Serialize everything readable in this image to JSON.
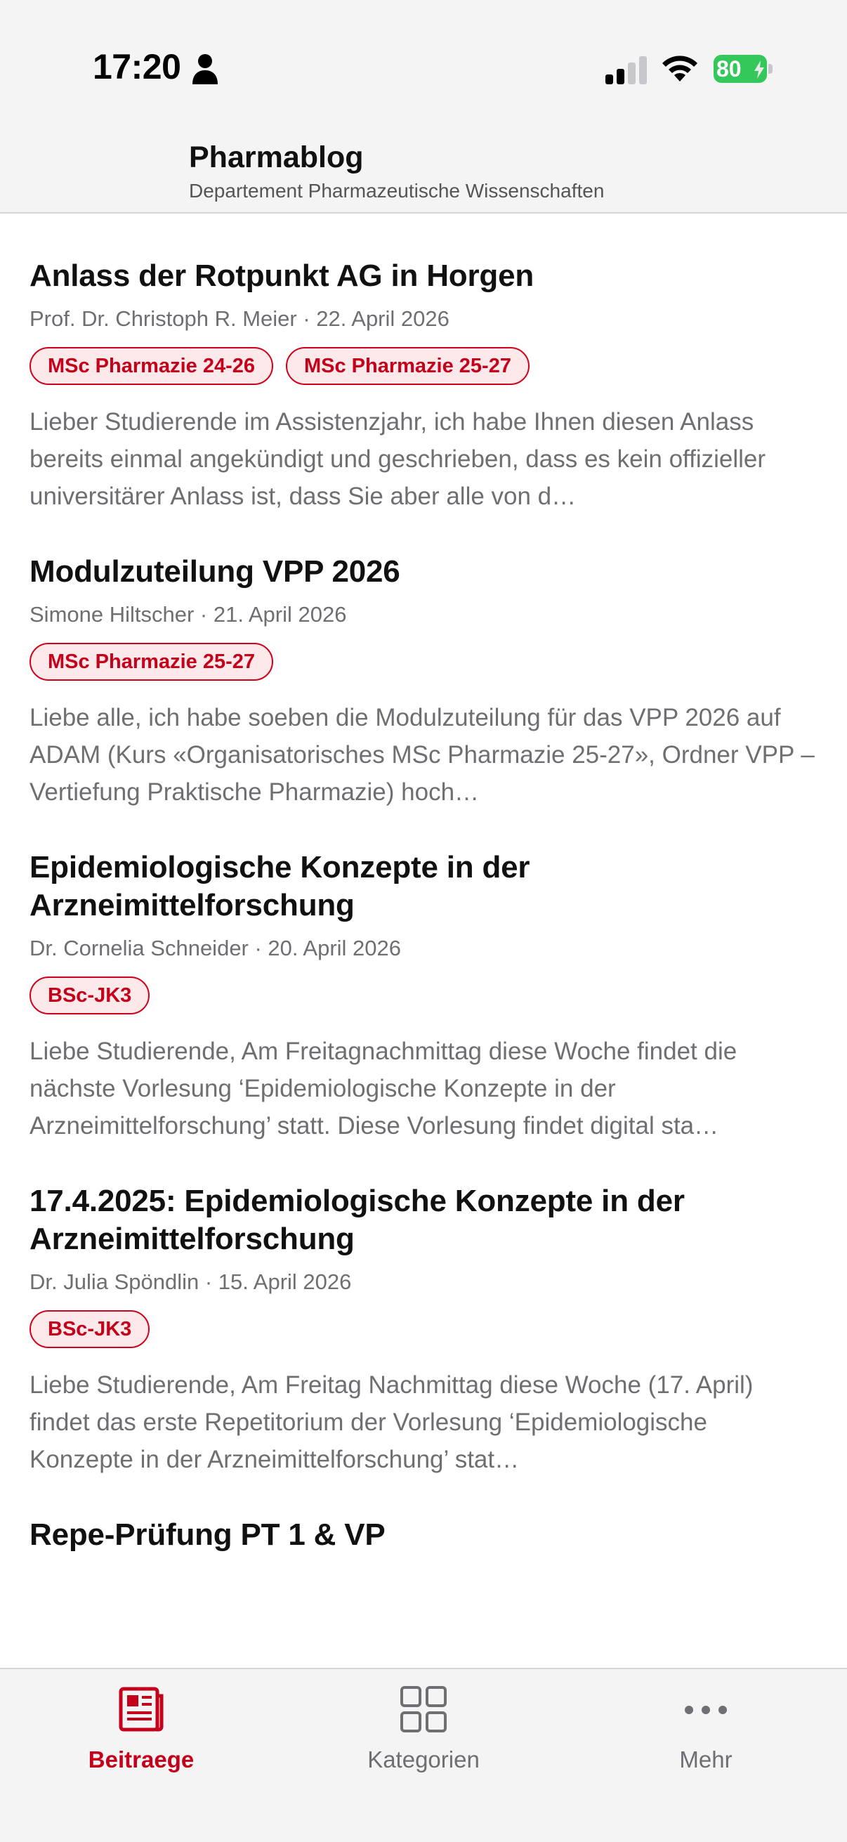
{
  "status_bar": {
    "time": "17:20",
    "battery": "80"
  },
  "header": {
    "title": "Pharmablog",
    "subtitle": "Departement Pharmazeutische Wissenschaften"
  },
  "posts": [
    {
      "title": "Anlass der Rotpunkt AG in Horgen",
      "meta": "Prof. Dr. Christoph R. Meier · 22. April 2026",
      "tags": [
        "MSc Pharmazie 24-26",
        "MSc Pharmazie 25-27"
      ],
      "excerpt": "Lieber Studierende im Assistenzjahr, ich habe Ihnen diesen Anlass bereits einmal angekündigt und geschrieben, dass es kein offizieller universitärer Anlass ist, dass Sie aber alle von d…"
    },
    {
      "title": "Modulzuteilung VPP 2026",
      "meta": "Simone Hiltscher · 21. April 2026",
      "tags": [
        "MSc Pharmazie 25-27"
      ],
      "excerpt": "Liebe alle, ich habe soeben die Modulzuteilung für das VPP 2026 auf ADAM (Kurs «Organisatorisches MSc Pharmazie 25-27», Ordner VPP – Vertiefung Praktische Pharmazie) hoch…"
    },
    {
      "title": "Epidemiologische Konzepte in der Arzneimittelforschung",
      "meta": "Dr. Cornelia Schneider · 20. April 2026",
      "tags": [
        "BSc-JK3"
      ],
      "excerpt": "Liebe Studierende, Am Freitagnachmittag diese Woche findet die nächste Vorlesung ‘Epidemiologische Konzepte in der Arzneimittelforschung’ statt. Diese Vorlesung findet digital sta…"
    },
    {
      "title": "17.4.2025: Epidemiologische Konzepte in der Arzneimittelforschung",
      "meta": "Dr. Julia Spöndlin · 15. April 2026",
      "tags": [
        "BSc-JK3"
      ],
      "excerpt": "Liebe Studierende, Am Freitag Nachmittag diese Woche (17. April) findet das erste Repetitorium der Vorlesung ‘Epidemiologische Konzepte in der Arzneimittelforschung’ stat…"
    },
    {
      "title": "Repe-Prüfung PT 1 & VP",
      "meta": "",
      "tags": [],
      "excerpt": ""
    }
  ],
  "tabbar": {
    "items": [
      {
        "label": "Beitraege",
        "icon": "newspaper-icon",
        "active": true
      },
      {
        "label": "Kategorien",
        "icon": "grid-icon",
        "active": false
      },
      {
        "label": "Mehr",
        "icon": "more-dots-icon",
        "active": false
      }
    ]
  },
  "colors": {
    "accent": "#c4001a",
    "tag_background": "#fde8ea",
    "battery_green": "#34c759",
    "bar_background": "#f4f4f5"
  }
}
